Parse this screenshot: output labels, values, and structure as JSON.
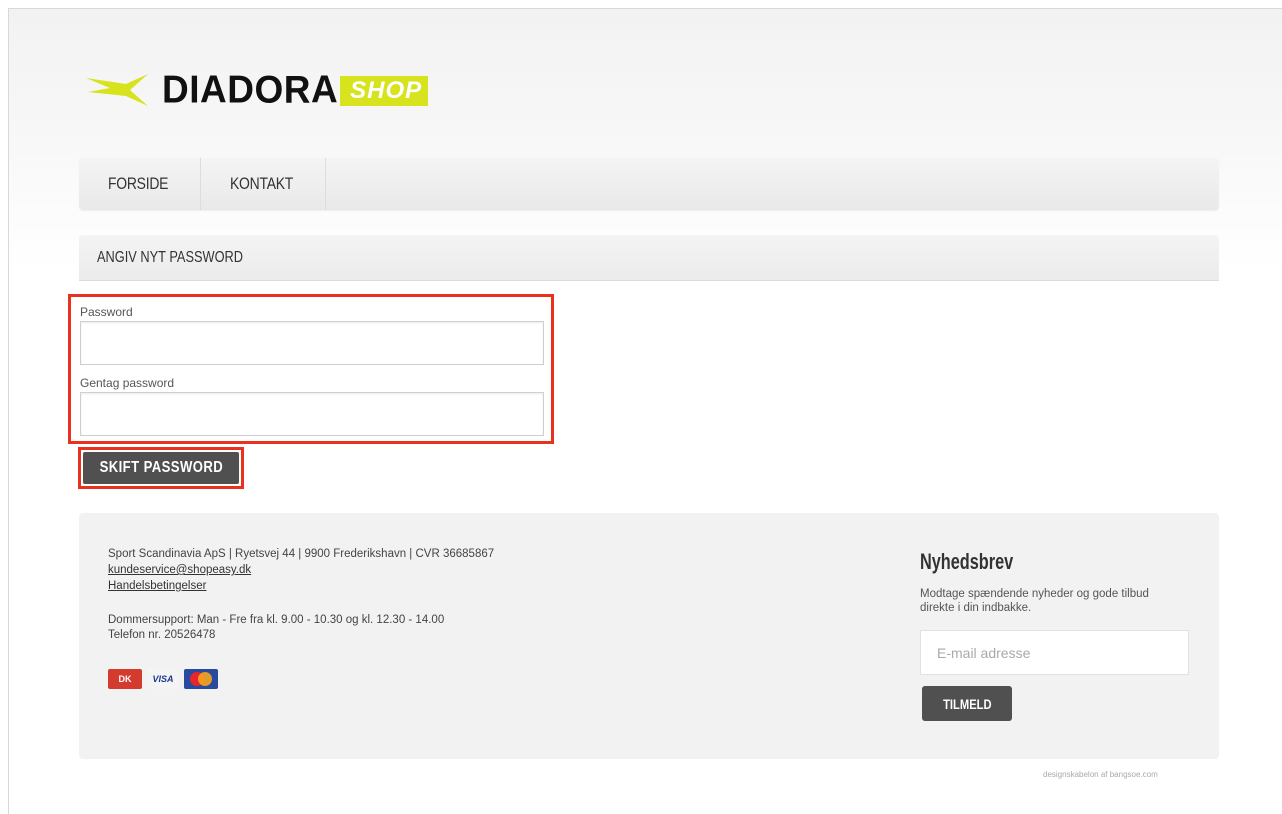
{
  "logo": {
    "word": "DIADORA",
    "badge": "SHOP",
    "brand_color": "#d6e31d",
    "icon": "diadora-arrow-icon"
  },
  "nav": {
    "items": [
      {
        "label": "FORSIDE"
      },
      {
        "label": "KONTAKT"
      }
    ]
  },
  "section": {
    "title": "ANGIV NYT PASSWORD"
  },
  "form": {
    "password_label": "Password",
    "password_value": "",
    "repeat_label": "Gentag password",
    "repeat_value": "",
    "submit_label": "SKIFT PASSWORD",
    "highlight_color": "#e8321e"
  },
  "footer": {
    "company_line": "Sport Scandinavia ApS | Ryetsvej 44 | 9900 Frederikshavn | CVR 36685867",
    "email": "kundeservice@shopeasy.dk",
    "terms": "Handelsbetingelser",
    "support_line": "Dommersupport: Man - Fre fra kl. 9.00 - 10.30 og kl. 12.30 - 14.00",
    "phone_line": "Telefon nr. 20526478",
    "payment_cards": [
      {
        "name": "dankort-icon",
        "label": "DK"
      },
      {
        "name": "visa-icon",
        "label": "VISA"
      },
      {
        "name": "mastercard-icon",
        "label": ""
      }
    ]
  },
  "newsletter": {
    "title": "Nyhedsbrev",
    "description": "Modtage spændende nyheder og gode tilbud direkte i din indbakke.",
    "placeholder": "E-mail adresse",
    "button_label": "TILMELD"
  },
  "credit": "designskabelon af bangsoe.com"
}
